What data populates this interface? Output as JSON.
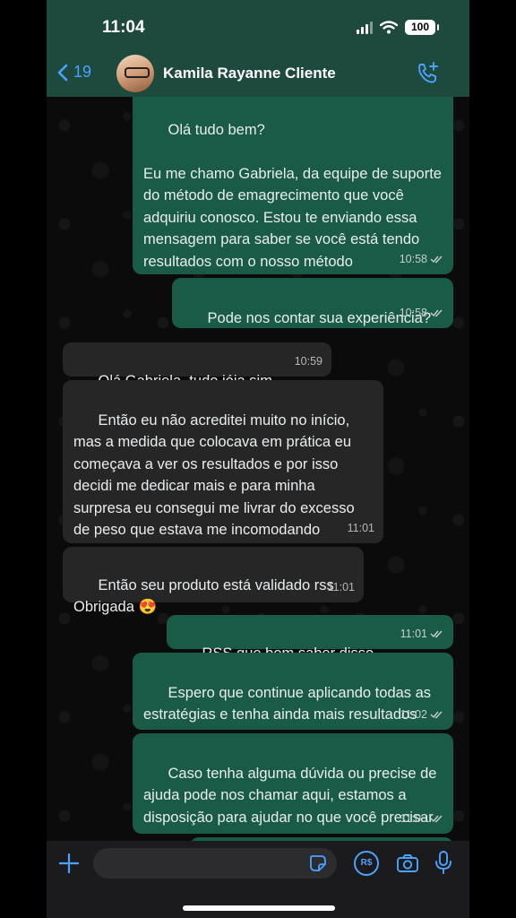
{
  "status_bar": {
    "time": "11:04",
    "battery": "100"
  },
  "header": {
    "back_count": "19",
    "contact_name": "Kamila Rayanne Cliente"
  },
  "messages": [
    {
      "direction": "out",
      "text": "Olá tudo bem?\n\nEu me chamo Gabriela, da equipe de suporte do método de emagrecimento que você adquiriu conosco. Estou te enviando essa mensagem para saber se você está tendo resultados com o nosso método",
      "time": "10:58"
    },
    {
      "direction": "out",
      "text": "Pode nos contar sua experiência?",
      "time": "10:58"
    },
    {
      "direction": "in",
      "text": "Olá Gabriela, tudo jóia sim",
      "time": "10:59"
    },
    {
      "direction": "in",
      "text": "Então eu não acreditei muito no início, mas a medida que colocava em prática eu começava a ver os resultados e por isso decidi me dedicar mais e para minha surpresa eu consegui me livrar do excesso de peso que estava me incomodando",
      "time": "11:01"
    },
    {
      "direction": "in",
      "text": "Então seu produto está validado rss Obrigada 😍",
      "time": "11:01"
    },
    {
      "direction": "out",
      "text": "RSS que bom saber disso",
      "time": "11:01"
    },
    {
      "direction": "out",
      "text": "Espero que continue aplicando todas as estratégias e tenha ainda mais resultados",
      "time": "11:02"
    },
    {
      "direction": "out",
      "text": "Caso tenha alguma dúvida ou precise de ajuda pode nos chamar aqui, estamos a disposição para ajudar no que você precisar",
      "time": "11:03"
    }
  ],
  "input_bar": {
    "pay_label": "R$"
  },
  "icons": {
    "back": "chevron-left-icon",
    "call_add": "phone-plus-icon",
    "plus": "plus-icon",
    "sticker": "sticker-icon",
    "pay": "payment-icon",
    "camera": "camera-icon",
    "mic": "microphone-icon"
  },
  "colors": {
    "header_bg": "#1d4a3d",
    "outgoing_bubble": "#195b47",
    "incoming_bubble": "#262626",
    "accent_blue": "#4aa3ff"
  }
}
